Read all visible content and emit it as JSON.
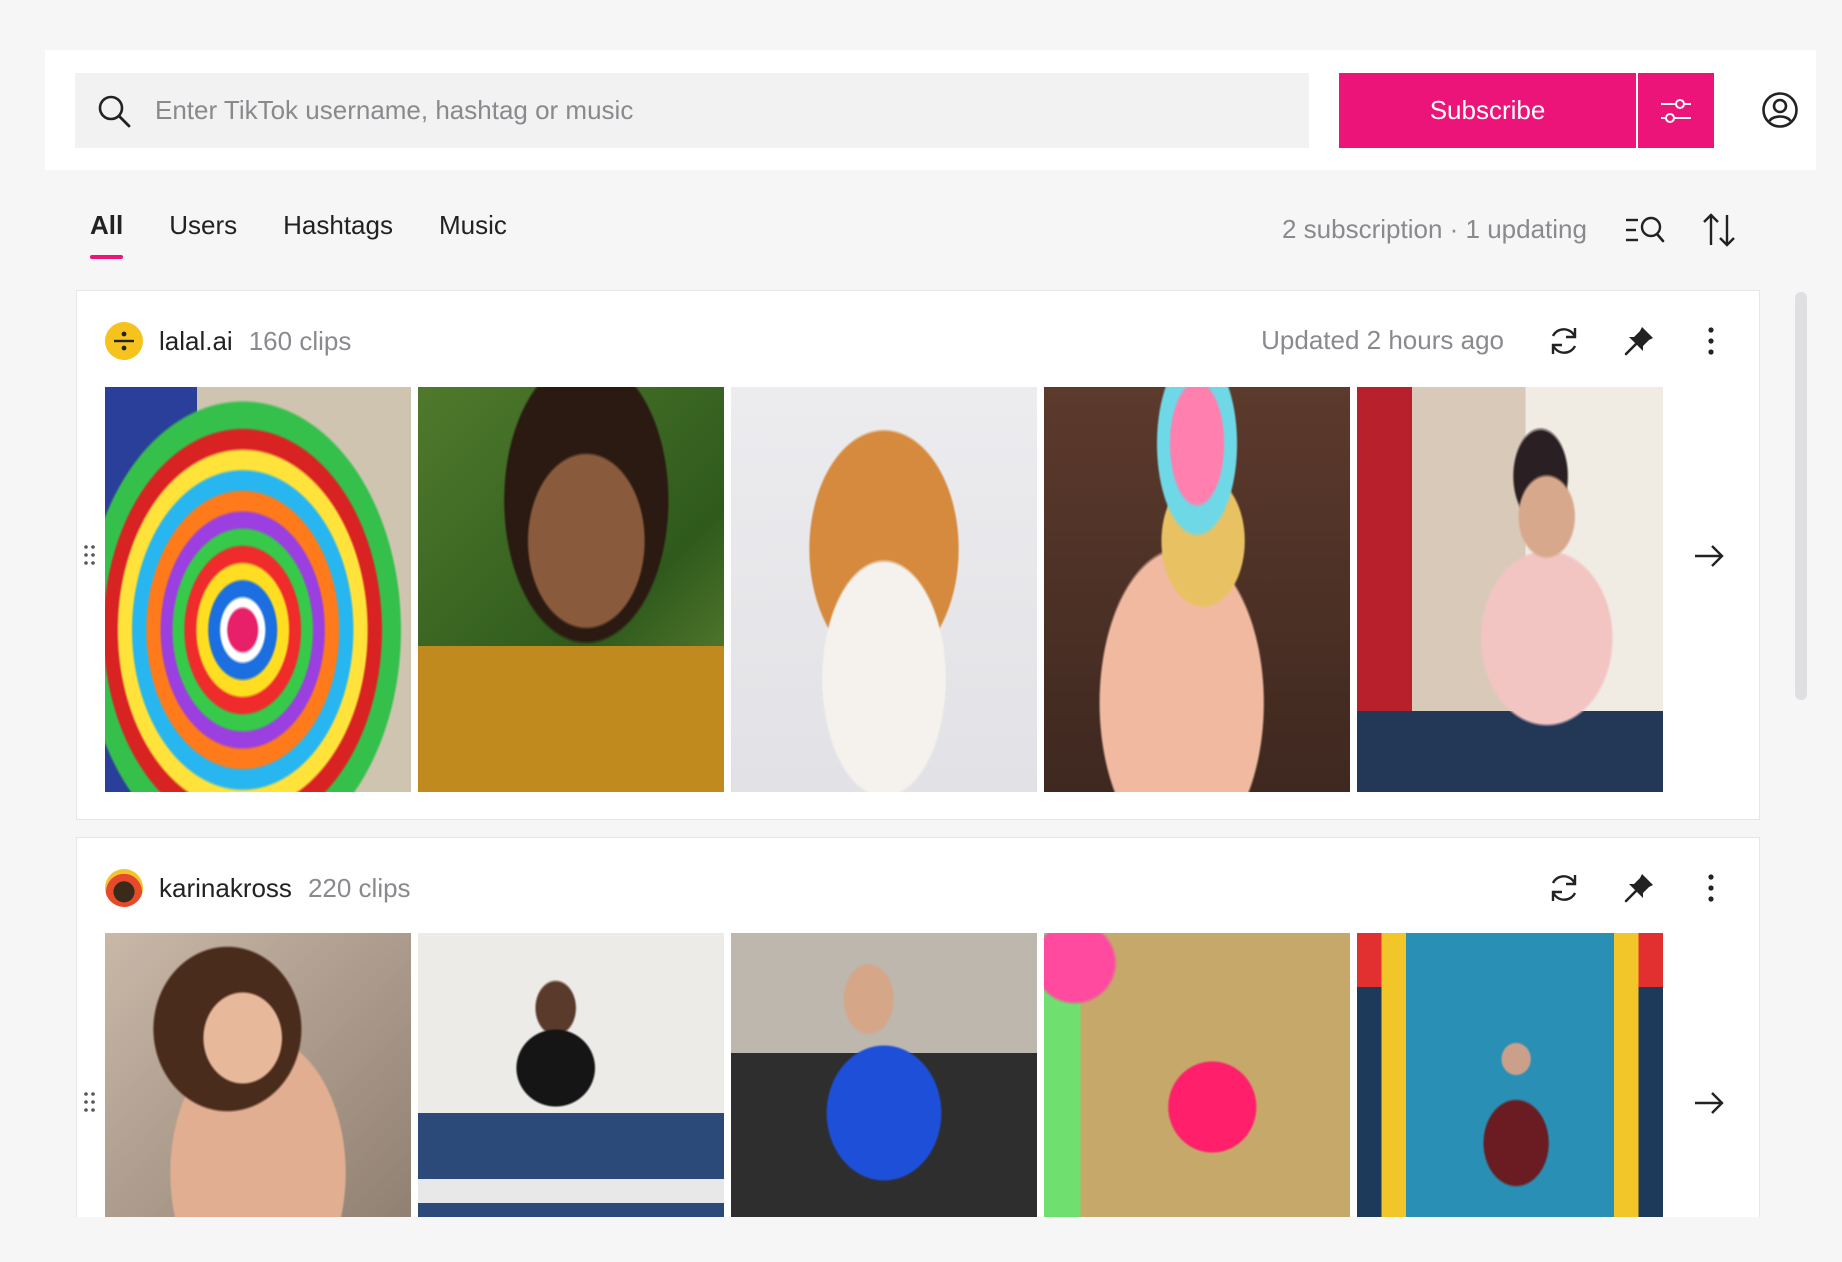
{
  "search": {
    "placeholder": "Enter TikTok username, hashtag or music",
    "value": ""
  },
  "header": {
    "subscribe_label": "Subscribe"
  },
  "tabs": [
    {
      "label": "All",
      "active": true
    },
    {
      "label": "Users",
      "active": false
    },
    {
      "label": "Hashtags",
      "active": false
    },
    {
      "label": "Music",
      "active": false
    }
  ],
  "status": {
    "text": "2 subscription · 1 updating"
  },
  "colors": {
    "accent": "#ec1479",
    "muted_text": "#8a8a8e"
  },
  "subscriptions": [
    {
      "username": "lalal.ai",
      "clips": "160 clips",
      "updated": "Updated 2 hours ago",
      "avatar_icon": "lalal-ai-logo-icon",
      "thumbnails": [
        "rainbow-paint-swirl",
        "smiling-person",
        "shiba-inu-dog",
        "ice-cream-cone",
        "woman-with-cricket-bat"
      ]
    },
    {
      "username": "karinakross",
      "clips": "220 clips",
      "updated": "",
      "avatar_icon": "karinakross-avatar-icon",
      "thumbnails": [
        "woman-long-hair",
        "man-in-tuxedo-shirt",
        "woman-with-blue-tarp",
        "pink-paint-bucket",
        "man-on-stage"
      ]
    }
  ]
}
